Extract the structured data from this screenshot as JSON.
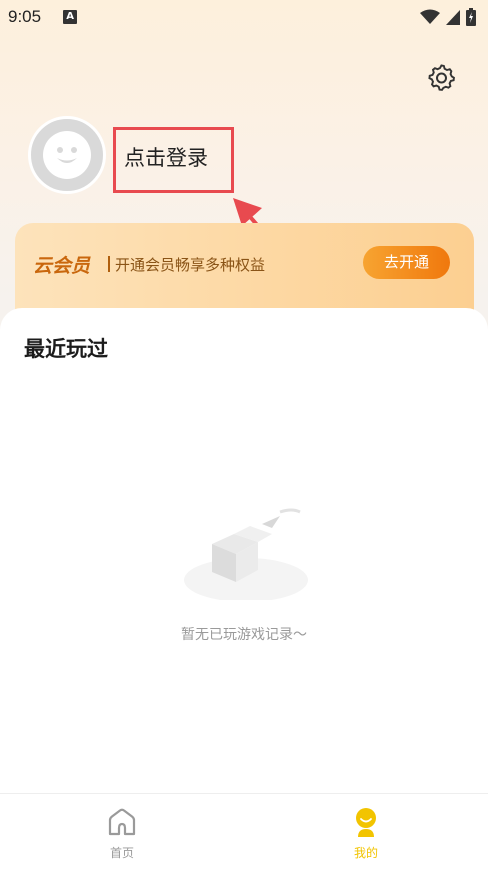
{
  "status_bar": {
    "time": "9:05",
    "notification_letter": "A"
  },
  "header": {
    "settings_icon": "gear-icon"
  },
  "profile": {
    "avatar_icon": "smiley-face-icon",
    "login_label": "点击登录"
  },
  "vip": {
    "title": "云会员",
    "subtitle": "开通会员畅享多种权益",
    "button_label": "去开通"
  },
  "recent": {
    "title": "最近玩过",
    "empty_text": "暂无已玩游戏记录～",
    "empty_icon": "empty-box-icon"
  },
  "tab_bar": {
    "tabs": [
      {
        "label": "首页",
        "icon": "home-icon",
        "active": false
      },
      {
        "label": "我的",
        "icon": "profile-icon",
        "active": true
      }
    ]
  },
  "colors": {
    "accent": "#f2c400",
    "highlight": "#e84a4f",
    "vip_button": "#f0780d"
  }
}
